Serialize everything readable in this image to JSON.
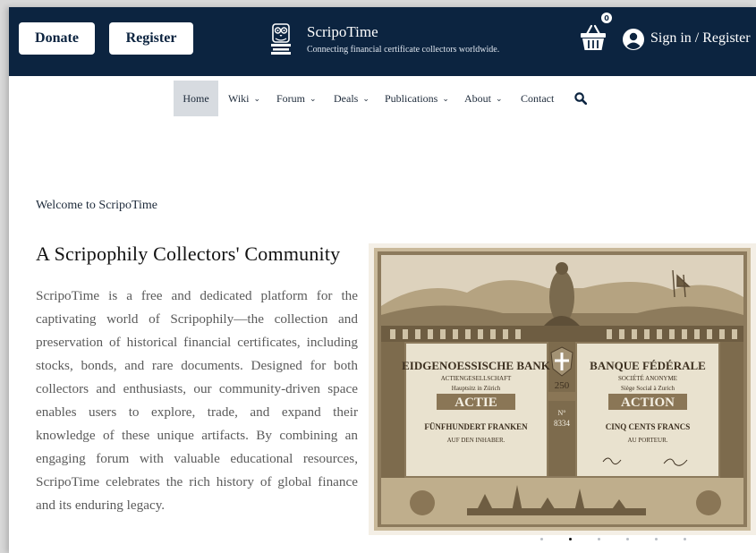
{
  "header": {
    "donate_label": "Donate",
    "register_label": "Register",
    "site_title": "ScripoTime",
    "tagline": "Connecting financial certificate collectors worldwide.",
    "cart_count": "0",
    "signin_label": "Sign in / Register",
    "bg_color": "#0c2440"
  },
  "nav": {
    "items": [
      {
        "label": "Home",
        "active": true
      },
      {
        "label": "Wiki",
        "dropdown": true
      },
      {
        "label": "Forum",
        "dropdown": true
      },
      {
        "label": "Deals",
        "dropdown": true
      },
      {
        "label": "Publications",
        "dropdown": true
      },
      {
        "label": "About",
        "dropdown": true
      },
      {
        "label": "Contact"
      }
    ]
  },
  "main": {
    "welcome": "Welcome to ScripoTime",
    "headline": "A Scripophily Collectors' Community",
    "body": "ScripoTime is a free and dedicated platform for the captivating world of Scripophily—the collection and preservation of historical financial certificates, including stocks, bonds, and rare documents. Designed for both collectors and enthusiasts, our community-driven space enables users to explore, trade, and expand their knowledge of these unique artifacts. By combining an engaging forum with valuable educational resources, ScripoTime celebrates the rich history of global finance and its enduring legacy."
  },
  "certificate": {
    "left_title": "EIDGENOESSISCHE BANK",
    "left_sub": "ACTIENGESELLSCHAFT",
    "left_city": "Hauptsitz in Zürich",
    "left_word": "ACTIE",
    "left_amount": "FÜNFHUNDERT FRANKEN",
    "left_bearer": "AUF DEN INHABER.",
    "denomination": "250",
    "number_label": "N°",
    "number": "8334",
    "right_title": "BANQUE FÉDÉRALE",
    "right_sub": "SOCIÉTÉ ANONYME",
    "right_city": "Siège Social à Zurich",
    "right_word": "ACTION",
    "right_amount": "CINQ CENTS FRANCS",
    "right_bearer": "AU PORTEUR."
  },
  "carousel": {
    "count": 6,
    "active_index": 1
  }
}
